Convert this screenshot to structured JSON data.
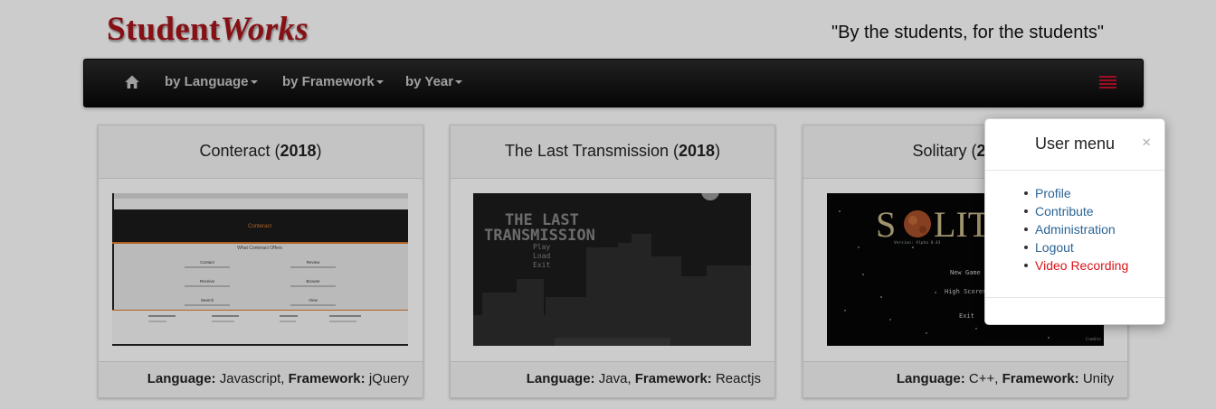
{
  "brand": {
    "part1": "Student",
    "part2": "Works",
    "color": "#a8141a"
  },
  "tagline": "\"By the students, for the students\"",
  "nav": {
    "home_icon": "home-icon",
    "items": [
      {
        "label": "by Language"
      },
      {
        "label": "by Framework"
      },
      {
        "label": "by Year"
      }
    ],
    "menu_icon": "hamburger-icon",
    "menu_color": "#c8102e"
  },
  "cards": [
    {
      "title": "Conteract",
      "year": "2018",
      "language": "Javascript",
      "framework": "jQuery"
    },
    {
      "title": "The Last Transmission",
      "year": "2018",
      "language": "Java",
      "framework": "Reactjs"
    },
    {
      "title": "Solitary",
      "year": "2018",
      "language": "C++",
      "framework": "Unity"
    }
  ],
  "labels": {
    "language": "Language:",
    "framework": "Framework:"
  },
  "conteract_shot": {
    "brand": "Conteract",
    "offers": "What Conteract Offers",
    "features": [
      "Contact",
      "Review",
      "Receive",
      "Browse",
      "Search",
      "View"
    ]
  },
  "transmission_shot": {
    "title_line1": "THE LAST",
    "title_line2": "TRANSMISSION",
    "menu": [
      "Play",
      "Load",
      "Exit"
    ]
  },
  "solitary_shot": {
    "logo_start": "S",
    "logo_end": "LIT",
    "version": "Version: Alpha 0.43",
    "menu": [
      "New Game",
      "High Scores",
      "Exit"
    ],
    "corner": "Credits"
  },
  "user_menu": {
    "title": "User menu",
    "close": "×",
    "items": [
      {
        "label": "Profile",
        "color": "#2a6496"
      },
      {
        "label": "Contribute",
        "color": "#2a6496"
      },
      {
        "label": "Administration",
        "color": "#2a6496"
      },
      {
        "label": "Logout",
        "color": "#2a6496"
      },
      {
        "label": "Video Recording",
        "color": "#d9131a"
      }
    ]
  }
}
